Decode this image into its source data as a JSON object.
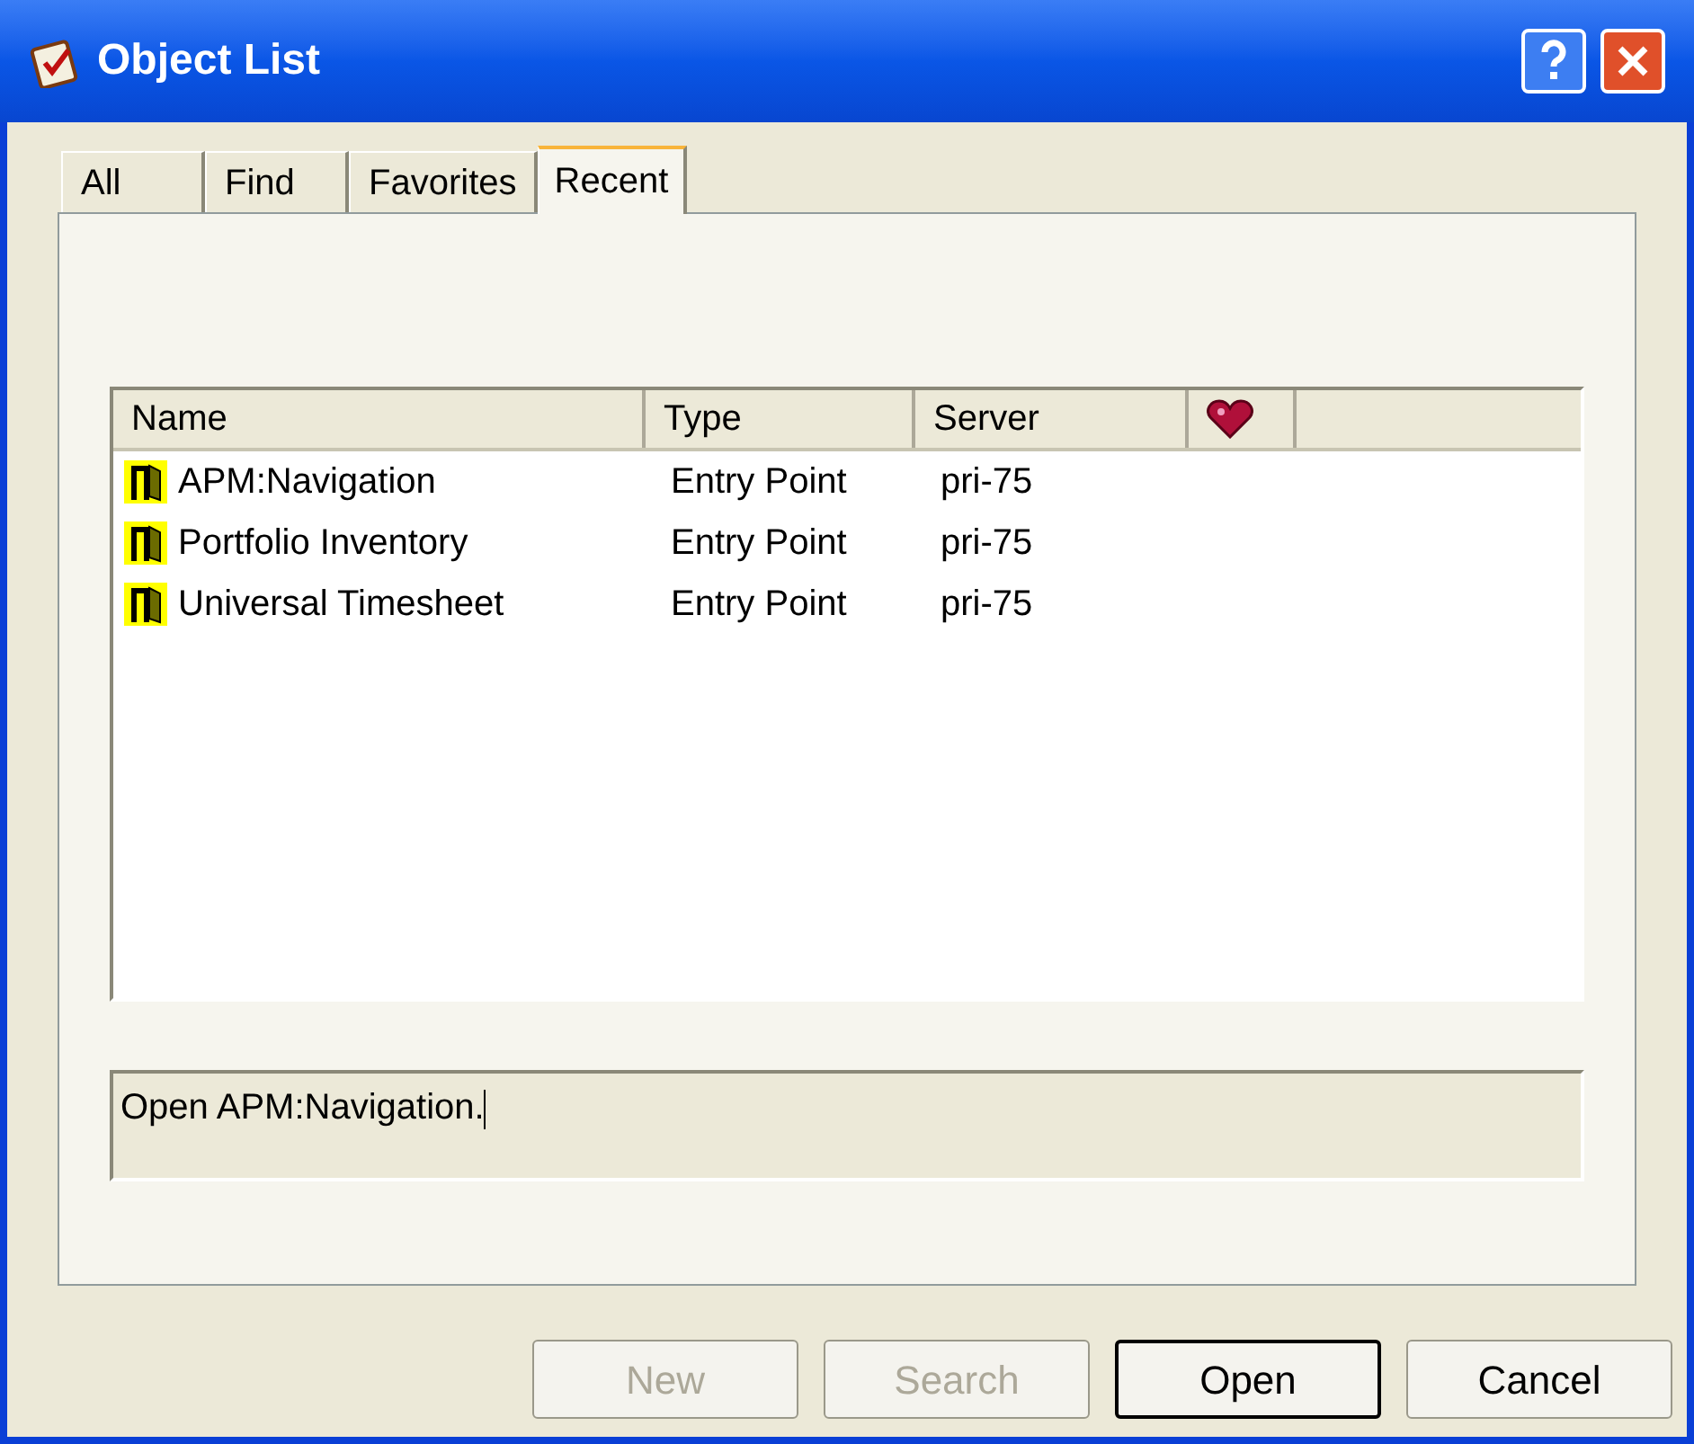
{
  "window": {
    "title": "Object List"
  },
  "tabs": [
    {
      "label": "All",
      "selected": false
    },
    {
      "label": "Find",
      "selected": false
    },
    {
      "label": "Favorites",
      "selected": false
    },
    {
      "label": "Recent",
      "selected": true
    }
  ],
  "table": {
    "columns": [
      {
        "kind": "text",
        "label": "Name"
      },
      {
        "kind": "text",
        "label": "Type"
      },
      {
        "kind": "text",
        "label": "Server"
      },
      {
        "kind": "favorite"
      }
    ],
    "rows": [
      {
        "name": "APM:Navigation",
        "type": "Entry Point",
        "server": "pri-75"
      },
      {
        "name": "Portfolio Inventory",
        "type": "Entry Point",
        "server": "pri-75"
      },
      {
        "name": "Universal Timesheet",
        "type": "Entry Point",
        "server": "pri-75"
      }
    ]
  },
  "description": "Open APM:Navigation.",
  "buttons": [
    {
      "label": "New",
      "disabled": true,
      "default": false
    },
    {
      "label": "Search",
      "disabled": true,
      "default": false
    },
    {
      "label": "Open",
      "disabled": false,
      "default": true
    },
    {
      "label": "Cancel",
      "disabled": false,
      "default": false
    }
  ]
}
